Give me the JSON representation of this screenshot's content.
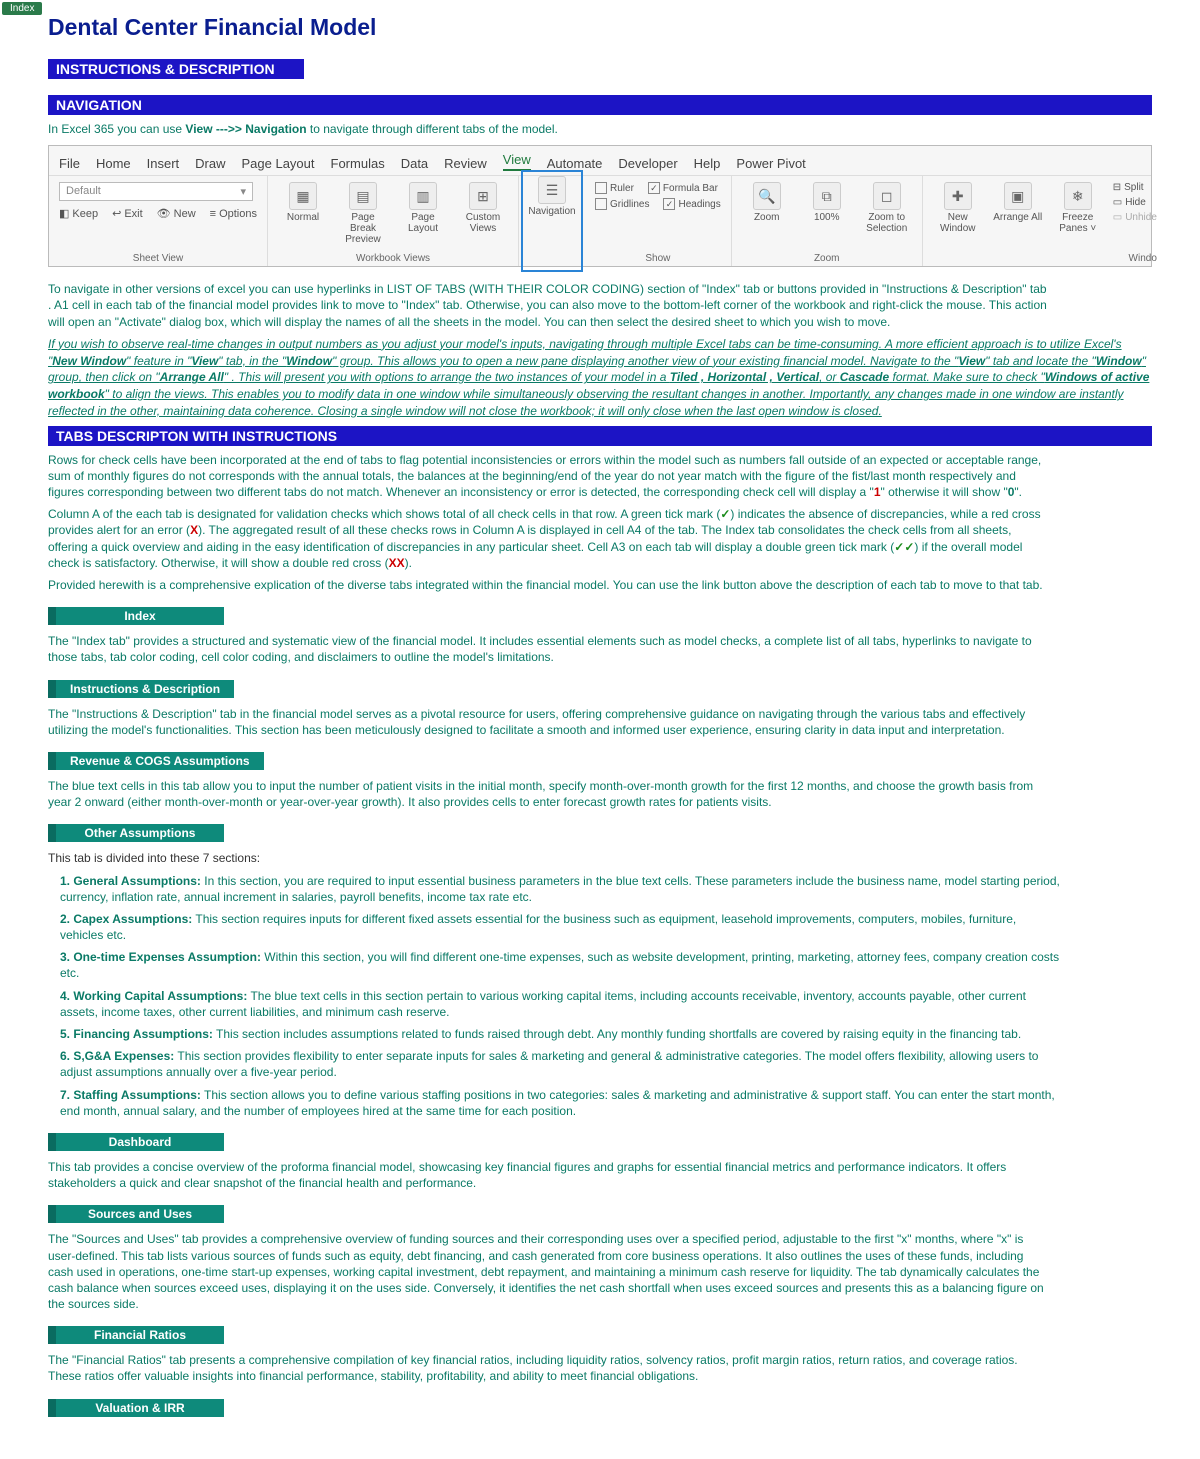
{
  "tabButton": "Index",
  "title": "Dental Center Financial Model",
  "sections": {
    "instructions": "INSTRUCTIONS & DESCRIPTION",
    "navigation": "NAVIGATION",
    "tabsDesc": "TABS DESCRIPTON WITH INSTRUCTIONS"
  },
  "navIntro": {
    "p1a": "In Excel 365 you can use ",
    "p1b": "View  --->> Navigation",
    "p1c": " to navigate through different tabs of the model."
  },
  "ribbon": {
    "tabs": [
      "File",
      "Home",
      "Insert",
      "Draw",
      "Page Layout",
      "Formulas",
      "Data",
      "Review",
      "View",
      "Automate",
      "Developer",
      "Help",
      "Power Pivot"
    ],
    "sheetView": {
      "combo": "Default",
      "keep": "Keep",
      "exit": "Exit",
      "new": "New",
      "options": "Options",
      "group": "Sheet View"
    },
    "workbookViews": {
      "normal": "Normal",
      "pageBreak": "Page Break Preview",
      "pageLayout": "Page Layout",
      "custom": "Custom Views",
      "group": "Workbook Views"
    },
    "navItem": "Navigation",
    "show": {
      "ruler": "Ruler",
      "gridlines": "Gridlines",
      "formulaBar": "Formula Bar",
      "headings": "Headings",
      "group": "Show"
    },
    "zoom": {
      "zoom": "Zoom",
      "hundred": "100%",
      "zoomSel": "Zoom to Selection",
      "group": "Zoom"
    },
    "window": {
      "newWin": "New Window",
      "arrange": "Arrange All",
      "freeze": "Freeze Panes ˅",
      "split": "Split",
      "hide": "Hide",
      "unhide": "Unhide",
      "group": "Windo"
    }
  },
  "navPara": "To navigate in other versions of excel you can use hyperlinks in LIST OF TABS (WITH THEIR COLOR CODING) section of \"Index\" tab or buttons provided in  \"Instructions & Description\" tab . A1 cell in each tab of the financial model provides link to move to \"Index\" tab. Otherwise, you can also move to the bottom-left corner of the workbook and right-click the mouse. This action will open an \"Activate\" dialog box, which will display the names of all the sheets in the model. You can then select the desired sheet to which you wish to move.",
  "navEm": {
    "t1": "If you wish to observe real-time changes in output numbers as you adjust your model's inputs, navigating through multiple Excel tabs can be time-consuming. A more efficient approach is to utilize Excel's \"",
    "b1": "New Window",
    "t2": "\" feature in \"",
    "b2": "View",
    "t3": "\"  tab, in the \"",
    "b3": "Window",
    "t4": "\" group. This allows you to open a new pane displaying another view of your existing financial model. Navigate to the \"",
    "b4": "View",
    "t5": "\" tab and locate the \"",
    "b5": "Window",
    "t6": "\" group, then click on \"",
    "b6": "Arrange All",
    "t7": "\" . This will present you with options to arrange the two instances of your model in a ",
    "b7": "Tiled ,  Horizontal ,  Vertical",
    "t8": ", or ",
    "b8": "Cascade",
    "t9": "  format. Make sure to check \"",
    "b9": "Windows of active workbook",
    "t10": "\" to align the views. This  enables you to modify data in one window while simultaneously observing the resultant changes in another. Importantly, any changes made in one window are instantly reflected in the other, maintaining data coherence. Closing a single window will not close the workbook; it will only close when the last open window is closed."
  },
  "tabsDescP1": {
    "t1": "Rows for check cells have been incorporated at the end of tabs to flag potential inconsistencies or errors within the model such as numbers fall outside of an expected or acceptable range, sum of monthly figures do not corresponds with the annual totals, the balances at the beginning/end of the year do not year match with the figure of the fist/last month respectively and figures corresponding between two different tabs do not match. Whenever an inconsistency or error is detected, the corresponding check cell will display a \"",
    "one": "1",
    "t2": "\" otherwise it will show \"",
    "zero": "0",
    "t3": "\"."
  },
  "tabsDescP2": {
    "t1": "Column A of the each tab is designated for validation checks which shows total of all check cells in that row. A green tick mark (",
    "tick": "✓",
    "t2": ") indicates the absence of discrepancies, while a red cross provides alert for an error (",
    "cross": "X",
    "t3": "). The aggregated result of all these checks rows in Column A is displayed in cell A4 of the tab. The Index tab consolidates the check cells from all sheets, offering a quick overview and aiding in the easy identification of discrepancies in any particular sheet. Cell A3 on each tab will display a double green tick mark (",
    "ticktick": "✓✓",
    "t4": ") if the overall model check is satisfactory. Otherwise, it will show a double red cross (",
    "xx": "XX",
    "t5": ")."
  },
  "tabsDescP3": "Provided herewith is a comprehensive explication of the diverse tabs integrated within the financial model. You can use the link button above the description of each tab to move to that tab.",
  "tabs": {
    "index": {
      "label": "Index",
      "desc": "The \"Index tab\" provides a structured and systematic view of the financial model. It includes essential elements such as model checks, a complete list of all tabs, hyperlinks to navigate to those tabs, tab color coding, cell color coding, and disclaimers to outline the model's limitations."
    },
    "instr": {
      "label": "Instructions & Description",
      "desc": "The \"Instructions & Description\" tab in the financial model serves as a pivotal resource for users, offering comprehensive guidance on navigating through the various tabs and effectively utilizing the model's functionalities. This section has been meticulously designed to facilitate a smooth and informed user experience, ensuring clarity in data input and interpretation."
    },
    "rev": {
      "label": "Revenue & COGS Assumptions",
      "desc": "The blue text cells in this tab allow you to input the number of patient visits in the initial month, specify month-over-month growth for the first 12 months, and choose the growth basis from year 2 onward (either month-over-month or year-over-year growth). It also provides cells to enter forecast growth rates for patients visits."
    },
    "other": {
      "label": "Other Assumptions",
      "intro": "This tab is divided into these 7 sections:",
      "items": [
        {
          "b": "1. General Assumptions:",
          "t": " In this section, you are required to input essential business parameters in the blue text cells. These parameters include the business name, model starting period, currency, inflation rate, annual increment in salaries, payroll benefits, income tax rate etc."
        },
        {
          "b": "2. Capex Assumptions:",
          "t": " This section requires inputs for different fixed assets essential for the business such as equipment, leasehold improvements, computers, mobiles, furniture, vehicles etc."
        },
        {
          "b": "3. One-time Expenses Assumption:",
          "t": " Within this section, you will find different one-time expenses, such as website development, printing, marketing, attorney fees, company creation costs etc."
        },
        {
          "b": "4. Working Capital Assumptions:",
          "t": " The blue text cells in this section pertain to various working capital items, including accounts receivable, inventory, accounts payable, other current assets, income taxes, other current liabilities, and minimum cash reserve."
        },
        {
          "b": "5. Financing Assumptions:",
          "t": " This section includes assumptions related to funds raised through debt. Any monthly funding shortfalls are covered by raising equity in the financing tab."
        },
        {
          "b": "6. S,G&A Expenses:",
          "t": " This section provides flexibility to enter separate inputs for sales & marketing and general & administrative categories.  The model offers flexibility, allowing users to adjust assumptions annually  over a five-year period."
        },
        {
          "b": "7. Staffing Assumptions:",
          "t": " This section allows you to define various staffing positions in two categories: sales & marketing and administrative & support staff. You can enter the start month, end month, annual salary, and the number of employees hired at the same time for each position."
        }
      ]
    },
    "dash": {
      "label": "Dashboard",
      "desc": "This tab provides a concise overview of the proforma financial model, showcasing key financial figures and graphs for essential financial metrics and performance indicators. It offers stakeholders a quick and clear snapshot of the financial health and performance."
    },
    "sources": {
      "label": "Sources and Uses",
      "desc": "The \"Sources and Uses\" tab provides a comprehensive overview of funding sources and their corresponding uses over a specified period, adjustable to the first \"x\" months, where \"x\" is user-defined. This tab lists various sources of funds such as equity, debt financing, and cash generated from core business operations. It also outlines the uses of these funds, including cash used in operations, one-time start-up expenses, working capital investment, debt repayment, and maintaining  a minimum cash reserve for liquidity. The tab dynamically calculates the cash balance when sources exceed uses, displaying it on the uses side. Conversely, it identifies the net cash shortfall when uses exceed sources and presents this as a balancing figure on the sources side."
    },
    "ratios": {
      "label": "Financial Ratios",
      "desc": "The \"Financial Ratios\" tab presents a comprehensive compilation of key financial ratios, including liquidity ratios, solvency ratios, profit margin ratios, return ratios, and coverage ratios. These ratios offer valuable insights into financial performance, stability, profitability, and ability to meet financial obligations."
    },
    "val": {
      "label": "Valuation & IRR"
    }
  }
}
